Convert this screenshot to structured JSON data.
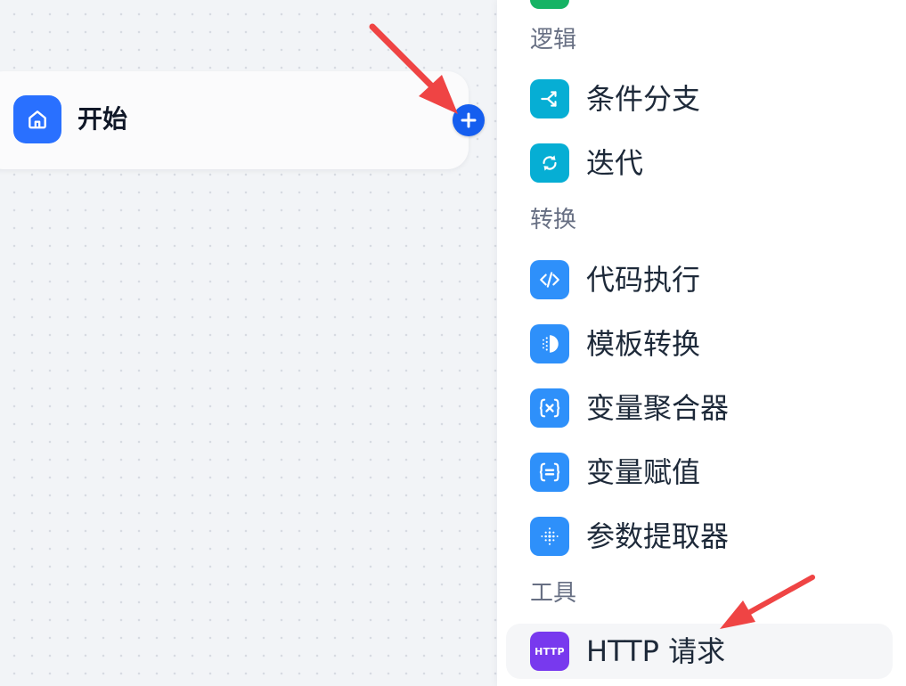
{
  "canvas": {
    "start_node": {
      "title": "开始",
      "icon": "home-icon",
      "color": "#2970ff"
    },
    "add_button": {
      "icon": "plus-icon",
      "color": "#155eef"
    }
  },
  "panel": {
    "sections": [
      {
        "title": "逻辑",
        "items": [
          {
            "label": "条件分支",
            "icon": "branch-icon",
            "color": "#06aed4"
          },
          {
            "label": "迭代",
            "icon": "loop-icon",
            "color": "#06aed4"
          }
        ]
      },
      {
        "title": "转换",
        "items": [
          {
            "label": "代码执行",
            "icon": "code-icon",
            "color": "#2e90fa"
          },
          {
            "label": "模板转换",
            "icon": "template-icon",
            "color": "#2e90fa"
          },
          {
            "label": "变量聚合器",
            "icon": "variable-x-icon",
            "color": "#2e90fa"
          },
          {
            "label": "变量赋值",
            "icon": "variable-assign-icon",
            "color": "#2e90fa"
          },
          {
            "label": "参数提取器",
            "icon": "parameter-extractor-icon",
            "color": "#2e90fa"
          }
        ]
      },
      {
        "title": "工具",
        "items": [
          {
            "label": "HTTP 请求",
            "icon": "http-icon",
            "icon_text": "HTTP",
            "color": "#7839ee"
          }
        ]
      }
    ]
  },
  "annotations": {
    "arrow_color": "#ef4444"
  }
}
